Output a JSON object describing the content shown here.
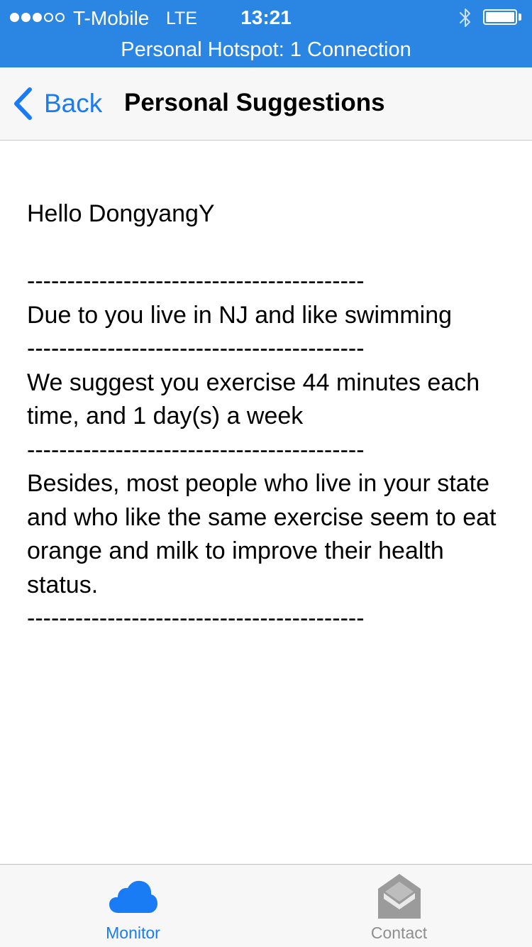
{
  "status_bar": {
    "signal_filled": 3,
    "signal_total": 5,
    "carrier": "T-Mobile",
    "network": "LTE",
    "time": "13:21",
    "bluetooth_icon": "bluetooth-icon",
    "battery_icon": "battery-icon",
    "battery_level": 1.0,
    "hotspot": "Personal Hotspot: 1 Connection"
  },
  "nav": {
    "back_label": "Back",
    "title": "Personal Suggestions",
    "back_icon": "chevron-left-icon"
  },
  "content": {
    "greeting": "Hello DongyangY",
    "divider": "------------------------------------------",
    "reason": "Due to you live in NJ and like swimming",
    "suggestion": "We suggest you exercise 44 minutes each time, and 1 day(s) a week",
    "besides": "Besides, most people who live in your state and who like the same exercise seem to eat orange and milk to improve their health status."
  },
  "tab_bar": {
    "tabs": [
      {
        "label": "Monitor",
        "icon": "cloud-icon",
        "selected": true
      },
      {
        "label": "Contact",
        "icon": "envelope-icon",
        "selected": false
      }
    ]
  },
  "colors": {
    "status_blue": "#2b86e3",
    "accent": "#1a7cf5",
    "inactive": "#8e8e8e"
  }
}
